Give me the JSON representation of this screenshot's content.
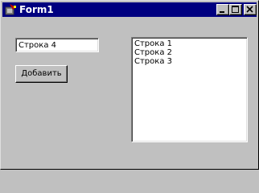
{
  "window": {
    "title": "Form1",
    "colors": {
      "titlebar": "#000080",
      "face": "#c0c0c0",
      "title_text": "#ffffff"
    },
    "icons": {
      "app": "app-icon",
      "minimize": "minimize-icon",
      "maximize": "maximize-icon",
      "close": "close-icon"
    }
  },
  "form": {
    "edit_value": "Строка 4",
    "add_button_label": "Добавить"
  },
  "listbox": {
    "items": [
      "Строка 1",
      "Строка 2",
      "Строка 3"
    ]
  }
}
